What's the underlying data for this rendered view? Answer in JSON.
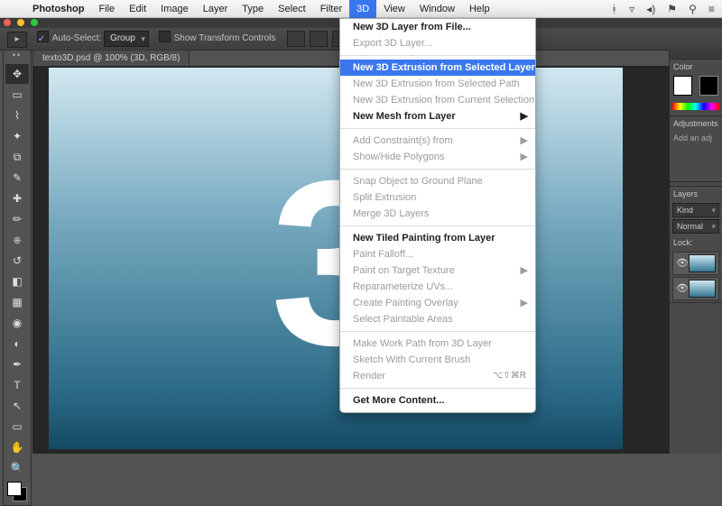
{
  "menubar": {
    "apple": "",
    "items": [
      "Photoshop",
      "File",
      "Edit",
      "Image",
      "Layer",
      "Type",
      "Select",
      "Filter",
      "3D",
      "View",
      "Window",
      "Help"
    ],
    "open_index": 8
  },
  "status_icons": [
    "bt",
    "wifi",
    "spk",
    "flag",
    "srch",
    "list"
  ],
  "options_bar": {
    "tool_glyph": "▸",
    "auto_select_checked": true,
    "auto_select_label": "Auto-Select:",
    "auto_select_mode": "Group",
    "show_transform_checked": false,
    "show_transform_label": "Show Transform Controls"
  },
  "doc_tab": "texto3D.psd @ 100% (3D, RGB/8)",
  "canvas": {
    "big_text": "3"
  },
  "toolbox": {
    "tools": [
      {
        "name": "move-tool",
        "glyph": "✥",
        "active": true
      },
      {
        "name": "marquee-tool",
        "glyph": "▭"
      },
      {
        "name": "lasso-tool",
        "glyph": "⌇"
      },
      {
        "name": "wand-tool",
        "glyph": "✦"
      },
      {
        "name": "crop-tool",
        "glyph": "⧉"
      },
      {
        "name": "eyedropper-tool",
        "glyph": "✎"
      },
      {
        "name": "heal-tool",
        "glyph": "✚"
      },
      {
        "name": "brush-tool",
        "glyph": "✏"
      },
      {
        "name": "stamp-tool",
        "glyph": "⎈"
      },
      {
        "name": "history-brush-tool",
        "glyph": "↺"
      },
      {
        "name": "eraser-tool",
        "glyph": "◧"
      },
      {
        "name": "gradient-tool",
        "glyph": "▦"
      },
      {
        "name": "blur-tool",
        "glyph": "◉"
      },
      {
        "name": "dodge-tool",
        "glyph": "◐"
      },
      {
        "name": "pen-tool",
        "glyph": "✒"
      },
      {
        "name": "type-tool",
        "glyph": "T"
      },
      {
        "name": "path-select-tool",
        "glyph": "↖"
      },
      {
        "name": "shape-tool",
        "glyph": "▭"
      },
      {
        "name": "hand-tool",
        "glyph": "✋"
      },
      {
        "name": "zoom-tool",
        "glyph": "🔍"
      }
    ]
  },
  "panels": {
    "color_label": "Color",
    "adjustments_label": "Adjustments",
    "add_adjustment": "Add an adj",
    "layers_label": "Layers",
    "kind_label": "Kind",
    "blend_mode": "Normal",
    "lock_label": "Lock:"
  },
  "menu_3d": {
    "groups": [
      [
        {
          "label": "New 3D Layer from File...",
          "bold": true
        },
        {
          "label": "Export 3D Layer...",
          "disabled": true
        }
      ],
      [
        {
          "label": "New 3D Extrusion from Selected Layer",
          "bold": true,
          "highlight": true
        },
        {
          "label": "New 3D Extrusion from Selected Path",
          "disabled": true
        },
        {
          "label": "New 3D Extrusion from Current Selection",
          "disabled": true
        },
        {
          "label": "New Mesh from Layer",
          "bold": true,
          "submenu": true
        }
      ],
      [
        {
          "label": "Add Constraint(s) from",
          "disabled": true,
          "submenu": true
        },
        {
          "label": "Show/Hide Polygons",
          "disabled": true,
          "submenu": true
        }
      ],
      [
        {
          "label": "Snap Object to Ground Plane",
          "disabled": true
        },
        {
          "label": "Split Extrusion",
          "disabled": true
        },
        {
          "label": "Merge 3D Layers",
          "disabled": true
        }
      ],
      [
        {
          "label": "New Tiled Painting from Layer",
          "bold": true
        },
        {
          "label": "Paint Falloff...",
          "disabled": true
        },
        {
          "label": "Paint on Target Texture",
          "disabled": true,
          "submenu": true
        },
        {
          "label": "Reparameterize UVs...",
          "disabled": true
        },
        {
          "label": "Create Painting Overlay",
          "disabled": true,
          "submenu": true
        },
        {
          "label": "Select Paintable Areas",
          "disabled": true
        }
      ],
      [
        {
          "label": "Make Work Path from 3D Layer",
          "disabled": true
        },
        {
          "label": "Sketch With Current Brush",
          "disabled": true
        },
        {
          "label": "Render",
          "disabled": true,
          "shortcut": "⌥⇧⌘R"
        }
      ],
      [
        {
          "label": "Get More Content...",
          "bold": true
        }
      ]
    ]
  }
}
